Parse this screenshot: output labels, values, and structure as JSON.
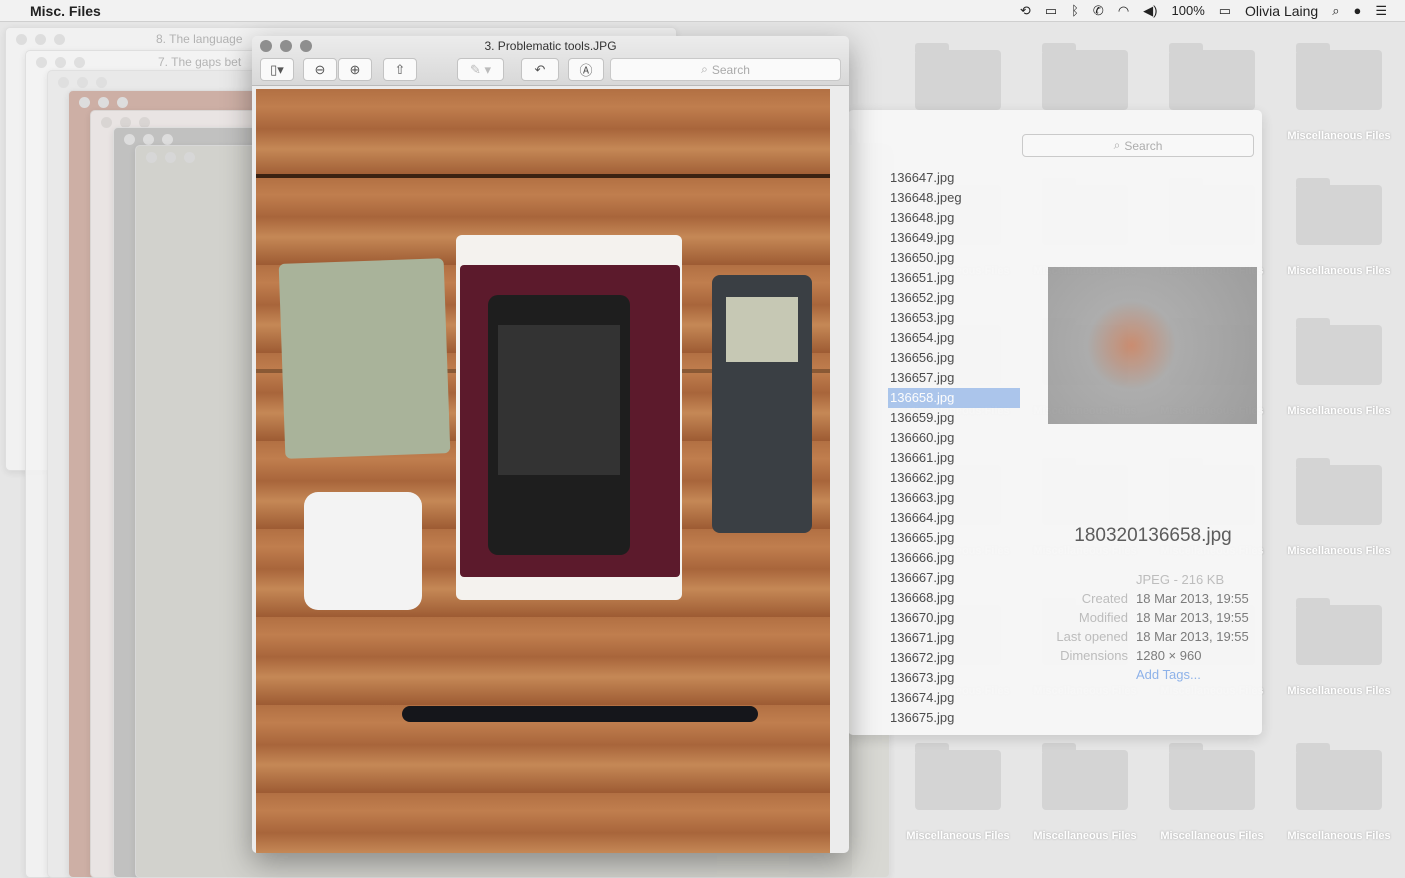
{
  "menubar": {
    "app_name": "Misc. Files",
    "battery": "100%",
    "user": "Olivia Laing",
    "icons": [
      "apple-icon",
      "time-machine-icon",
      "airplay-icon",
      "bluetooth-icon",
      "phone-icon",
      "wifi-icon",
      "volume-icon",
      "battery-icon",
      "spotlight-icon",
      "siri-icon",
      "notification-center-icon"
    ]
  },
  "background_windows": [
    "8. The language",
    "7. The gaps bet"
  ],
  "preview": {
    "title": "3. Problematic tools.JPG",
    "search_placeholder": "Search"
  },
  "finder": {
    "search_placeholder": "Search",
    "files": [
      "136647.jpg",
      "136648.jpeg",
      "136648.jpg",
      "136649.jpg",
      "136650.jpg",
      "136651.jpg",
      "136652.jpg",
      "136653.jpg",
      "136654.jpg",
      "136656.jpg",
      "136657.jpg",
      "136658.jpg",
      "136659.jpg",
      "136660.jpg",
      "136661.jpg",
      "136662.jpg",
      "136663.jpg",
      "136664.jpg",
      "136665.jpg",
      "136666.jpg",
      "136667.jpg",
      "136668.jpg",
      "136670.jpg",
      "136671.jpg",
      "136672.jpg",
      "136673.jpg",
      "136674.jpg",
      "136675.jpg"
    ],
    "selected_index": 11,
    "selected_name": "180320136658.jpg",
    "kind": "JPEG - 216 KB",
    "info": [
      {
        "k": "Created",
        "v": "18 Mar 2013, 19:55"
      },
      {
        "k": "Modified",
        "v": "18 Mar 2013, 19:55"
      },
      {
        "k": "Last opened",
        "v": "18 Mar 2013, 19:55"
      },
      {
        "k": "Dimensions",
        "v": "1280 × 960"
      }
    ],
    "add_tags": "Add Tags..."
  },
  "desktop": {
    "folder_label": "Miscellaneous Files"
  }
}
